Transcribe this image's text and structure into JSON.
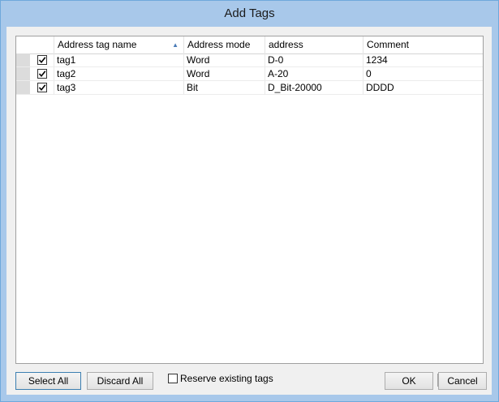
{
  "window": {
    "title": "Add Tags"
  },
  "table": {
    "columns": [
      "Address tag name",
      "Address mode",
      "address",
      "Comment"
    ],
    "rows": [
      {
        "checked": true,
        "name": "tag1",
        "mode": "Word",
        "address": "D-0",
        "comment": "1234"
      },
      {
        "checked": true,
        "name": "tag2",
        "mode": "Word",
        "address": "A-20",
        "comment": "0"
      },
      {
        "checked": true,
        "name": "tag3",
        "mode": "Bit",
        "address": "D_Bit-20000",
        "comment": "DDDD"
      }
    ],
    "sort_indicator": "▲"
  },
  "buttons": {
    "select_all": "Select All",
    "discard_all": "Discard All",
    "ok": "OK",
    "cancel": "Cancel"
  },
  "reserve": {
    "label": "Reserve existing tags",
    "checked": false
  },
  "colors": {
    "titlebar": "#a8c8ea",
    "client": "#f0f0f0"
  }
}
